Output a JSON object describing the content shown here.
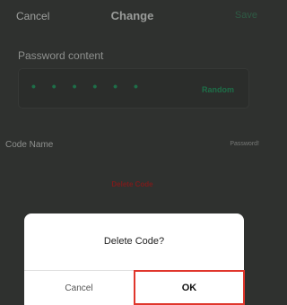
{
  "header": {
    "cancel_label": "Cancel",
    "title": "Change",
    "save_label": "Save"
  },
  "password": {
    "section_label": "Password content",
    "masked_value": "• • • • • •",
    "random_label": "Random"
  },
  "code_name": {
    "label": "Code Name",
    "value": "Password!"
  },
  "delete_code_label": "Delete Code",
  "dialog": {
    "message": "Delete Code?",
    "cancel_label": "Cancel",
    "ok_label": "OK"
  },
  "colors": {
    "accent_green": "#1e6e48",
    "danger_red": "#7a1c1c",
    "highlight_red": "#e0362c"
  }
}
